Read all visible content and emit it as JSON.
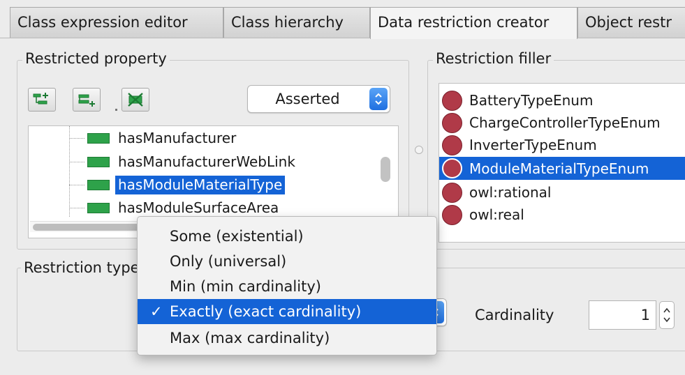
{
  "tabs": [
    {
      "label": "Class expression editor",
      "active": false
    },
    {
      "label": "Class hierarchy",
      "active": false
    },
    {
      "label": "Data restriction creator",
      "active": true
    },
    {
      "label": "Object restr",
      "active": false
    }
  ],
  "restricted_property": {
    "title": "Restricted property",
    "view_select": "Asserted",
    "tree_items": [
      {
        "label": "hasManufacturer",
        "selected": false
      },
      {
        "label": "hasManufacturerWebLink",
        "selected": false
      },
      {
        "label": "hasModuleMaterialType",
        "selected": true
      },
      {
        "label": "hasModuleSurfaceArea",
        "selected": false
      }
    ],
    "toolbar_icons": [
      "add-subproperty-icon",
      "add-sibling-property-icon",
      "delete-property-icon"
    ]
  },
  "restriction_filler": {
    "title": "Restriction filler",
    "items": [
      {
        "label": "BatteryTypeEnum",
        "selected": false
      },
      {
        "label": "ChargeControllerTypeEnum",
        "selected": false
      },
      {
        "label": "InverterTypeEnum",
        "selected": false
      },
      {
        "label": "ModuleMaterialTypeEnum",
        "selected": true
      },
      {
        "label": "owl:rational",
        "selected": false
      },
      {
        "label": "owl:real",
        "selected": false
      }
    ],
    "dot_color": "#b03a48"
  },
  "restriction_type": {
    "title": "Restriction type",
    "menu_options": [
      {
        "label": "Some (existential)",
        "selected": false
      },
      {
        "label": "Only (universal)",
        "selected": false
      },
      {
        "label": "Min (min cardinality)",
        "selected": false
      },
      {
        "label": "Exactly (exact cardinality)",
        "selected": true
      },
      {
        "label": "Max (max cardinality)",
        "selected": false
      }
    ],
    "check_mark": "✓",
    "cardinality_label": "Cardinality",
    "cardinality_value": "1"
  },
  "colors": {
    "selection": "#1463d6",
    "property_bar": "#2ea24a",
    "select_accent": "#1f6fe0"
  }
}
